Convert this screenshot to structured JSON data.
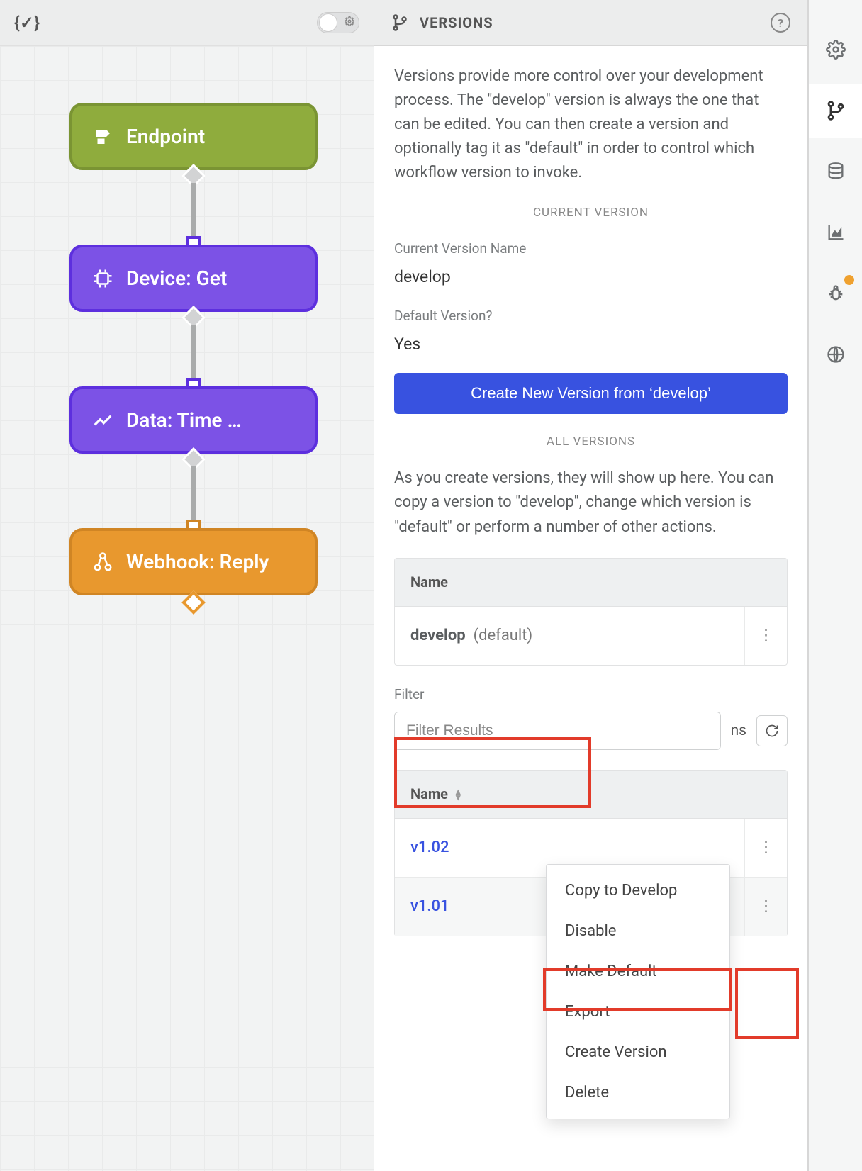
{
  "canvas": {
    "nodes": [
      {
        "label": "Endpoint",
        "icon": "plug"
      },
      {
        "label": "Device: Get",
        "icon": "chip"
      },
      {
        "label": "Data: Time …",
        "icon": "chart"
      },
      {
        "label": "Webhook: Reply",
        "icon": "lambda"
      }
    ]
  },
  "panel": {
    "title": "VERSIONS",
    "description": "Versions provide more control over your development process. The \"develop\" version is always the one that can be edited. You can then create a version and optionally tag it as \"default\" in order to control which workflow version to invoke.",
    "current_section": "CURRENT VERSION",
    "current_version_label": "Current Version Name",
    "current_version_value": "develop",
    "default_label": "Default Version?",
    "default_value": "Yes",
    "create_button": "Create New Version from ‘develop’",
    "all_section": "ALL VERSIONS",
    "all_description": "As you create versions, they will show up here. You can copy a version to \"develop\", change which version is \"default\" or perform a number of other actions.",
    "column_name": "Name",
    "develop_row_name": "develop",
    "develop_row_tag": "(default)",
    "filter_label": "Filter",
    "filter_placeholder": "Filter Results",
    "refresh_trailing_text": "ns",
    "list_column": "Name",
    "versions": [
      {
        "name": "v1.02"
      },
      {
        "name": "v1.01"
      }
    ]
  },
  "context_menu": {
    "items": [
      "Copy to Develop",
      "Disable",
      "Make Default",
      "Export",
      "Create Version",
      "Delete"
    ]
  },
  "rail": {
    "items": [
      "settings",
      "versions",
      "database",
      "analytics",
      "debug",
      "world"
    ]
  }
}
